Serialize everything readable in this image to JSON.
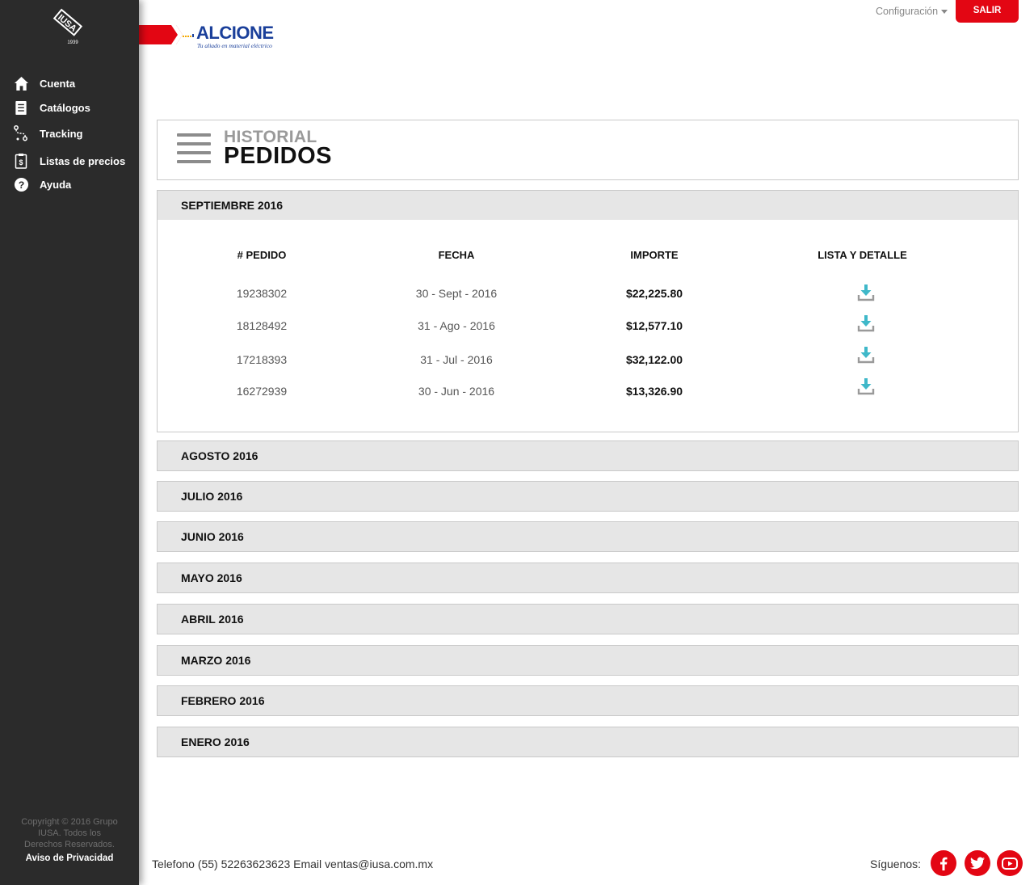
{
  "header": {
    "brand_name": "ALCIONE",
    "brand_tagline": "Tu aliado en material eléctrico",
    "config_label": "Configuración",
    "logout_label": "SALIR",
    "iusa_year": "1939",
    "iusa_logo_text": "IUSA"
  },
  "sidebar": {
    "items": [
      {
        "label": "Cuenta",
        "icon": "home-icon"
      },
      {
        "label": "Catálogos",
        "icon": "catalog-icon"
      },
      {
        "label": "Tracking",
        "icon": "tracking-icon"
      },
      {
        "label": "Listas de precios",
        "icon": "price-list-icon"
      },
      {
        "label": "Ayuda",
        "icon": "help-icon"
      }
    ],
    "copyright": "Copyright © 2016 Grupo IUSA. Todos los Derechos Reservados.",
    "privacy_label": "Aviso de Privacidad"
  },
  "page": {
    "title_sub": "HISTORIAL",
    "title_main": "PEDIDOS"
  },
  "orders": {
    "open_month": "SEPTIEMBRE 2016",
    "columns": [
      "# PEDIDO",
      "FECHA",
      "IMPORTE",
      "LISTA Y DETALLE"
    ],
    "rows": [
      {
        "pedido": "19238302",
        "fecha": "30 - Sept - 2016",
        "importe": "$22,225.80"
      },
      {
        "pedido": "18128492",
        "fecha": "31 - Ago - 2016",
        "importe": "$12,577.10"
      },
      {
        "pedido": "17218393",
        "fecha": "31 - Jul - 2016",
        "importe": "$32,122.00"
      },
      {
        "pedido": "16272939",
        "fecha": "30 - Jun - 2016",
        "importe": "$13,326.90"
      }
    ],
    "collapsed_months": [
      "AGOSTO 2016",
      "JULIO 2016",
      "JUNIO 2016",
      "MAYO 2016",
      "ABRIL 2016",
      "MARZO 2016",
      "FEBRERO 2016",
      "ENERO 2016"
    ]
  },
  "footer": {
    "contact": "Telefono (55) 52263623623  Email ventas@iusa.com.mx",
    "follow_label": "Síguenos:",
    "social": [
      "facebook-icon",
      "twitter-icon",
      "youtube-icon"
    ]
  },
  "colors": {
    "sidebar_bg": "#2b2b2b",
    "accent_red": "#e30613",
    "brand_blue": "#1a3f9a",
    "download_teal": "#3fb8c9",
    "row_header_bg": "#e6e6e6"
  }
}
